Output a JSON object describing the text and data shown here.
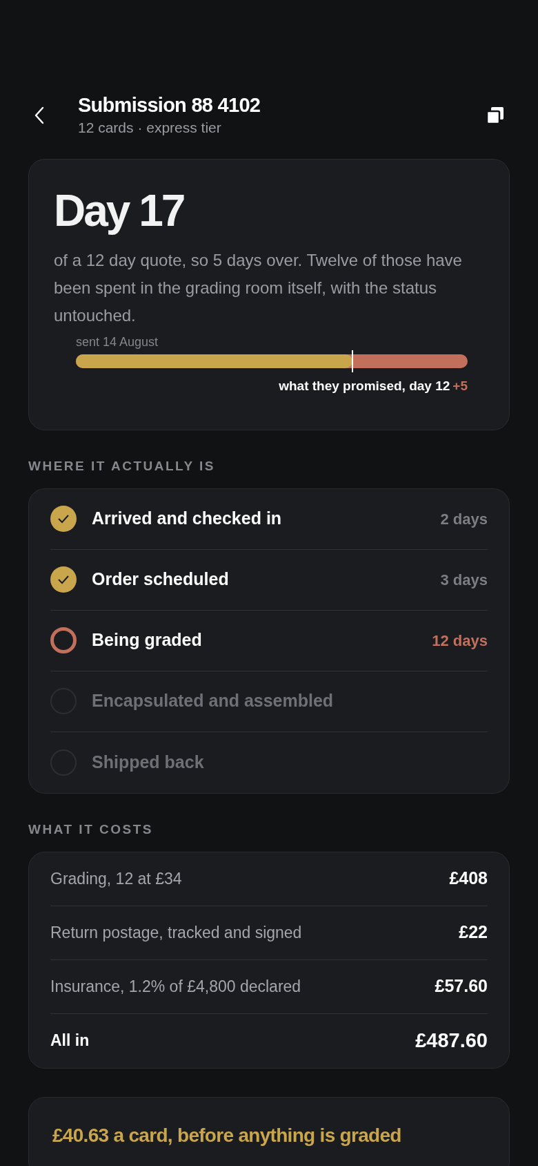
{
  "header": {
    "title": "Submission 88 4102",
    "subtitle": "12 cards · express tier"
  },
  "summary": {
    "headline": "Day 17",
    "text": "of a 12 day quote, so 5 days over. Twelve of those have been spent in the grading room itself, with the status untouched.",
    "start_label": "sent 14 August",
    "level": 0.706,
    "promise_label": "what they promised, day 12",
    "overrun": "+5"
  },
  "progress": {
    "heading": "WHERE IT ACTUALLY IS",
    "steps": [
      {
        "label": "Arrived and checked in",
        "kind": "done",
        "duration": "2 days"
      },
      {
        "label": "Order scheduled",
        "kind": "done",
        "duration": "3 days"
      },
      {
        "label": "Being graded",
        "kind": "current",
        "duration": "12 days"
      },
      {
        "label": "Encapsulated and assembled",
        "kind": "pending"
      },
      {
        "label": "Shipped back",
        "kind": "pending"
      }
    ]
  },
  "costs": {
    "heading": "WHAT IT COSTS",
    "lines": [
      {
        "label": "Grading, 12 at £34",
        "amount": "£408",
        "kind": "line"
      },
      {
        "label": "Return postage, tracked and signed",
        "amount": "£22",
        "kind": "line"
      },
      {
        "label": "Insurance, 1.2% of £4,800 declared",
        "amount": "£57.60",
        "kind": "line"
      },
      {
        "label": "All in",
        "amount": "£487.60",
        "kind": "total"
      }
    ]
  },
  "note": {
    "text": "£40.63 a card, before anything is graded"
  }
}
